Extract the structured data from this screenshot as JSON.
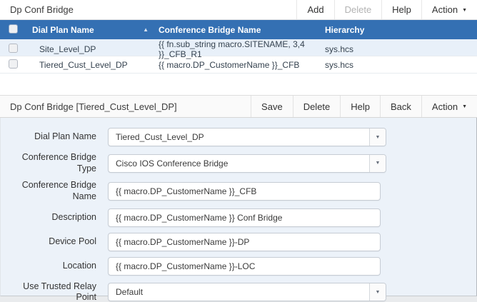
{
  "list_panel": {
    "title": "Dp Conf Bridge",
    "toolbar": {
      "add": "Add",
      "delete": "Delete",
      "help": "Help",
      "action": "Action"
    },
    "table": {
      "columns": {
        "dial_plan_name": "Dial Plan Name",
        "conference_bridge_name": "Conference Bridge Name",
        "hierarchy": "Hierarchy"
      },
      "sort": {
        "column": "Dial Plan Name",
        "direction": "ascending"
      },
      "rows": [
        {
          "dial_plan_name": "Site_Level_DP",
          "conference_bridge_name": "{{ fn.sub_string macro.SITENAME, 3,4 }}_CFB_R1",
          "hierarchy": "sys.hcs",
          "selected": true
        },
        {
          "dial_plan_name": "Tiered_Cust_Level_DP",
          "conference_bridge_name": "{{ macro.DP_CustomerName }}_CFB",
          "hierarchy": "sys.hcs",
          "selected": false
        }
      ]
    }
  },
  "detail_panel": {
    "title": "Dp Conf Bridge [Tiered_Cust_Level_DP]",
    "toolbar": {
      "save": "Save",
      "delete": "Delete",
      "help": "Help",
      "back": "Back",
      "action": "Action"
    },
    "fields": [
      {
        "label": "Dial Plan Name",
        "type": "select",
        "value": "Tiered_Cust_Level_DP"
      },
      {
        "label": "Conference Bridge Type",
        "type": "select",
        "value": "Cisco IOS Conference Bridge"
      },
      {
        "label": "Conference Bridge Name",
        "type": "text",
        "value": "{{ macro.DP_CustomerName }}_CFB"
      },
      {
        "label": "Description",
        "type": "text",
        "value": "{{ macro.DP_CustomerName }} Conf Bridge"
      },
      {
        "label": "Device Pool",
        "type": "text",
        "value": "{{ macro.DP_CustomerName }}-DP"
      },
      {
        "label": "Location",
        "type": "text",
        "value": "{{ macro.DP_CustomerName }}-LOC"
      },
      {
        "label": "Use Trusted Relay Point",
        "type": "select",
        "value": "Default"
      }
    ]
  },
  "colors": {
    "table_header_blue": "#3470b3",
    "selected_row": "#e8f0f9",
    "form_background": "#ecf2f9"
  }
}
